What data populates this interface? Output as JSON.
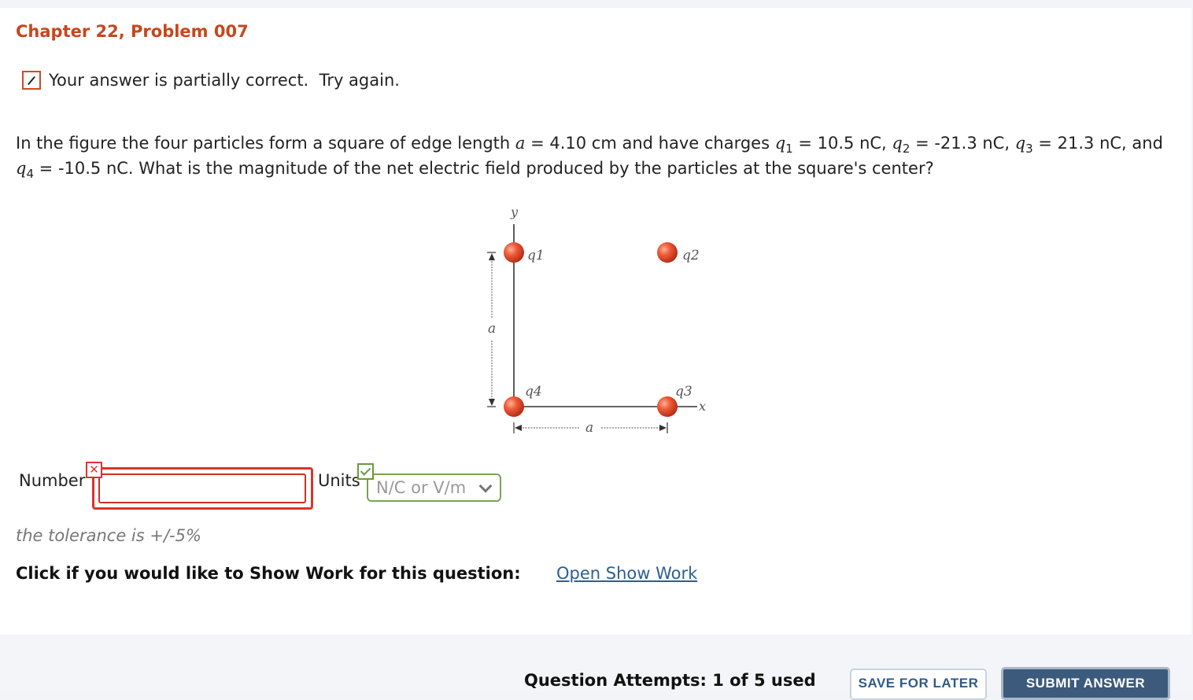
{
  "header": {
    "chapter_title": "Chapter 22, Problem 007"
  },
  "status": {
    "icon": "pencil-icon",
    "message": "Your answer is partially correct.  Try again."
  },
  "question": {
    "text_1": "In the figure the four particles form a square of edge length ",
    "a_symbol": "a",
    "text_2": " = 4.10 cm and have charges ",
    "q": "q",
    "sub_1": "1",
    "text_3": " = 10.5 nC, ",
    "sub_2": "2",
    "text_4": " = -21.3 nC, ",
    "sub_3": "3",
    "text_5": " = 21.3 nC, and ",
    "sub_4": "4",
    "text_6": " = -10.5 nC. What is the magnitude of the net electric field produced by the particles at the square's center?"
  },
  "figure": {
    "y_axis": "y",
    "x_axis": "x",
    "edge_label": "a",
    "q1": "q1",
    "q2": "q2",
    "q3": "q3",
    "q4": "q4",
    "particle_color": "#e8492b"
  },
  "answer": {
    "number_label": "Number",
    "number_value": "",
    "number_status": "incorrect",
    "units_label": "Units",
    "units_value": "N/C or V/m",
    "units_status": "correct"
  },
  "tolerance": "the tolerance is +/-5%",
  "show_work": {
    "prompt": "Click if you would like to Show Work for this question:",
    "link": "Open Show Work"
  },
  "footer": {
    "attempts": "Question Attempts: 1 of 5 used",
    "save_label": "SAVE FOR LATER",
    "submit_label": "SUBMIT ANSWER"
  },
  "colors": {
    "title": "#c7471d",
    "error": "#d8352b",
    "success": "#7ca152",
    "link": "#2d5f8f",
    "submit_bg": "#3c5a7c"
  }
}
